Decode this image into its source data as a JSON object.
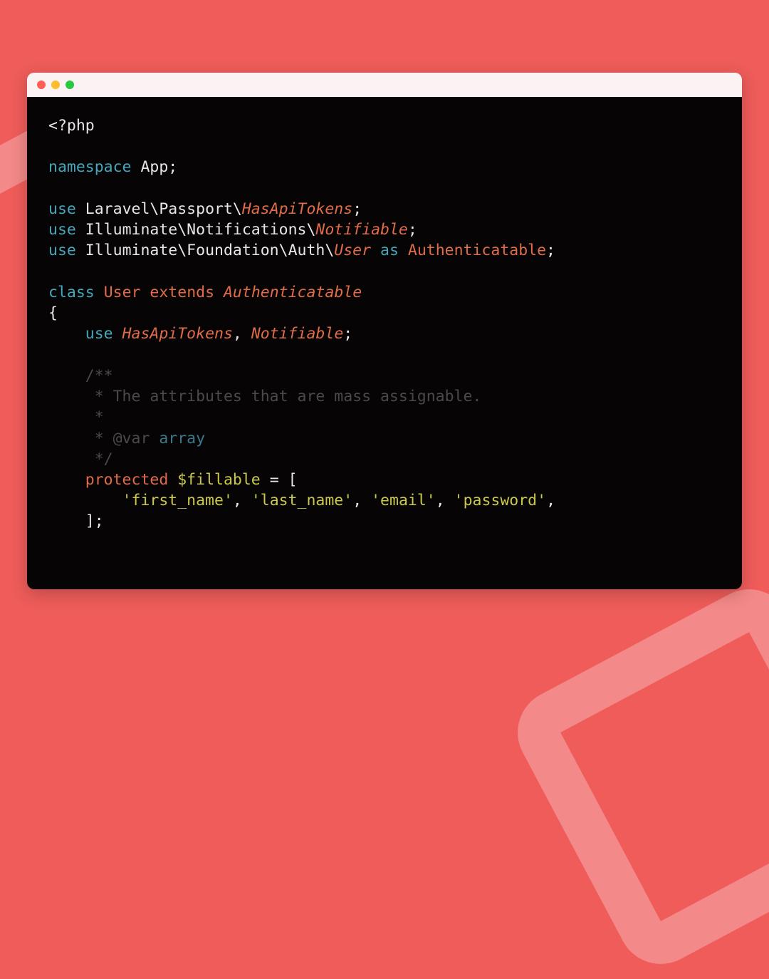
{
  "code": {
    "php_open": "<?php",
    "ns_kw": "namespace",
    "ns_name": "App",
    "use_kw": "use",
    "use1_path": "Laravel\\Passport\\",
    "use1_cls": "HasApiTokens",
    "use2_path": "Illuminate\\Notifications\\",
    "use2_cls": "Notifiable",
    "use3_path": "Illuminate\\Foundation\\Auth\\",
    "use3_cls": "User",
    "as_kw": "as",
    "as_name": "Authenticatable",
    "class_kw": "class",
    "class_name": "User",
    "extends_kw": "extends",
    "extends_name": "Authenticatable",
    "trait_use_kw": "use",
    "trait1": "HasApiTokens",
    "trait2": "Notifiable",
    "doc_open": "/**",
    "doc_line1": " * The attributes that are mass assignable.",
    "doc_blank": " *",
    "doc_var": " * @var",
    "doc_type": "array",
    "doc_close": " */",
    "protected_kw": "protected",
    "var_name": "$fillable",
    "eq": "=",
    "arr_open": "[",
    "fill_1": "'first_name'",
    "fill_2": "'last_name'",
    "fill_3": "'email'",
    "fill_4": "'password'",
    "arr_close": "];",
    "brace_open": "{",
    "brace_close": "}",
    "semi": ";",
    "comma": ","
  }
}
